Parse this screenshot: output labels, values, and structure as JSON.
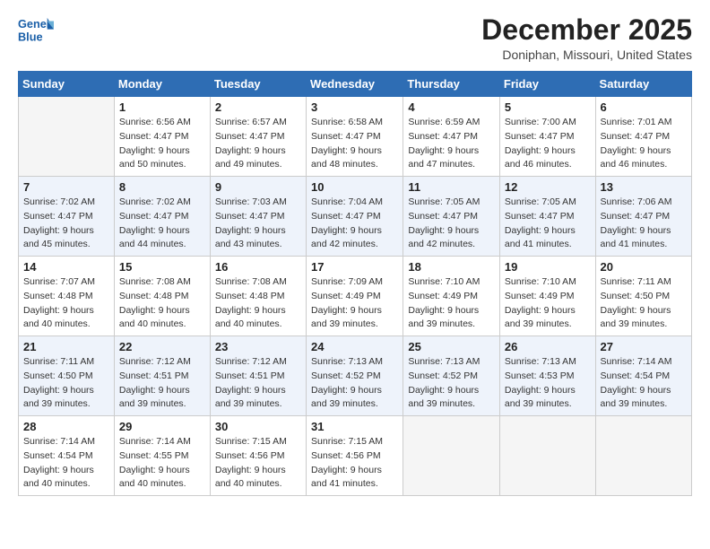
{
  "logo": {
    "general": "General",
    "blue": "Blue"
  },
  "title": "December 2025",
  "location": "Doniphan, Missouri, United States",
  "days_header": [
    "Sunday",
    "Monday",
    "Tuesday",
    "Wednesday",
    "Thursday",
    "Friday",
    "Saturday"
  ],
  "weeks": [
    [
      {
        "num": "",
        "sunrise": "",
        "sunset": "",
        "daylight": ""
      },
      {
        "num": "1",
        "sunrise": "Sunrise: 6:56 AM",
        "sunset": "Sunset: 4:47 PM",
        "daylight": "Daylight: 9 hours and 50 minutes."
      },
      {
        "num": "2",
        "sunrise": "Sunrise: 6:57 AM",
        "sunset": "Sunset: 4:47 PM",
        "daylight": "Daylight: 9 hours and 49 minutes."
      },
      {
        "num": "3",
        "sunrise": "Sunrise: 6:58 AM",
        "sunset": "Sunset: 4:47 PM",
        "daylight": "Daylight: 9 hours and 48 minutes."
      },
      {
        "num": "4",
        "sunrise": "Sunrise: 6:59 AM",
        "sunset": "Sunset: 4:47 PM",
        "daylight": "Daylight: 9 hours and 47 minutes."
      },
      {
        "num": "5",
        "sunrise": "Sunrise: 7:00 AM",
        "sunset": "Sunset: 4:47 PM",
        "daylight": "Daylight: 9 hours and 46 minutes."
      },
      {
        "num": "6",
        "sunrise": "Sunrise: 7:01 AM",
        "sunset": "Sunset: 4:47 PM",
        "daylight": "Daylight: 9 hours and 46 minutes."
      }
    ],
    [
      {
        "num": "7",
        "sunrise": "Sunrise: 7:02 AM",
        "sunset": "Sunset: 4:47 PM",
        "daylight": "Daylight: 9 hours and 45 minutes."
      },
      {
        "num": "8",
        "sunrise": "Sunrise: 7:02 AM",
        "sunset": "Sunset: 4:47 PM",
        "daylight": "Daylight: 9 hours and 44 minutes."
      },
      {
        "num": "9",
        "sunrise": "Sunrise: 7:03 AM",
        "sunset": "Sunset: 4:47 PM",
        "daylight": "Daylight: 9 hours and 43 minutes."
      },
      {
        "num": "10",
        "sunrise": "Sunrise: 7:04 AM",
        "sunset": "Sunset: 4:47 PM",
        "daylight": "Daylight: 9 hours and 42 minutes."
      },
      {
        "num": "11",
        "sunrise": "Sunrise: 7:05 AM",
        "sunset": "Sunset: 4:47 PM",
        "daylight": "Daylight: 9 hours and 42 minutes."
      },
      {
        "num": "12",
        "sunrise": "Sunrise: 7:05 AM",
        "sunset": "Sunset: 4:47 PM",
        "daylight": "Daylight: 9 hours and 41 minutes."
      },
      {
        "num": "13",
        "sunrise": "Sunrise: 7:06 AM",
        "sunset": "Sunset: 4:47 PM",
        "daylight": "Daylight: 9 hours and 41 minutes."
      }
    ],
    [
      {
        "num": "14",
        "sunrise": "Sunrise: 7:07 AM",
        "sunset": "Sunset: 4:48 PM",
        "daylight": "Daylight: 9 hours and 40 minutes."
      },
      {
        "num": "15",
        "sunrise": "Sunrise: 7:08 AM",
        "sunset": "Sunset: 4:48 PM",
        "daylight": "Daylight: 9 hours and 40 minutes."
      },
      {
        "num": "16",
        "sunrise": "Sunrise: 7:08 AM",
        "sunset": "Sunset: 4:48 PM",
        "daylight": "Daylight: 9 hours and 40 minutes."
      },
      {
        "num": "17",
        "sunrise": "Sunrise: 7:09 AM",
        "sunset": "Sunset: 4:49 PM",
        "daylight": "Daylight: 9 hours and 39 minutes."
      },
      {
        "num": "18",
        "sunrise": "Sunrise: 7:10 AM",
        "sunset": "Sunset: 4:49 PM",
        "daylight": "Daylight: 9 hours and 39 minutes."
      },
      {
        "num": "19",
        "sunrise": "Sunrise: 7:10 AM",
        "sunset": "Sunset: 4:49 PM",
        "daylight": "Daylight: 9 hours and 39 minutes."
      },
      {
        "num": "20",
        "sunrise": "Sunrise: 7:11 AM",
        "sunset": "Sunset: 4:50 PM",
        "daylight": "Daylight: 9 hours and 39 minutes."
      }
    ],
    [
      {
        "num": "21",
        "sunrise": "Sunrise: 7:11 AM",
        "sunset": "Sunset: 4:50 PM",
        "daylight": "Daylight: 9 hours and 39 minutes."
      },
      {
        "num": "22",
        "sunrise": "Sunrise: 7:12 AM",
        "sunset": "Sunset: 4:51 PM",
        "daylight": "Daylight: 9 hours and 39 minutes."
      },
      {
        "num": "23",
        "sunrise": "Sunrise: 7:12 AM",
        "sunset": "Sunset: 4:51 PM",
        "daylight": "Daylight: 9 hours and 39 minutes."
      },
      {
        "num": "24",
        "sunrise": "Sunrise: 7:13 AM",
        "sunset": "Sunset: 4:52 PM",
        "daylight": "Daylight: 9 hours and 39 minutes."
      },
      {
        "num": "25",
        "sunrise": "Sunrise: 7:13 AM",
        "sunset": "Sunset: 4:52 PM",
        "daylight": "Daylight: 9 hours and 39 minutes."
      },
      {
        "num": "26",
        "sunrise": "Sunrise: 7:13 AM",
        "sunset": "Sunset: 4:53 PM",
        "daylight": "Daylight: 9 hours and 39 minutes."
      },
      {
        "num": "27",
        "sunrise": "Sunrise: 7:14 AM",
        "sunset": "Sunset: 4:54 PM",
        "daylight": "Daylight: 9 hours and 39 minutes."
      }
    ],
    [
      {
        "num": "28",
        "sunrise": "Sunrise: 7:14 AM",
        "sunset": "Sunset: 4:54 PM",
        "daylight": "Daylight: 9 hours and 40 minutes."
      },
      {
        "num": "29",
        "sunrise": "Sunrise: 7:14 AM",
        "sunset": "Sunset: 4:55 PM",
        "daylight": "Daylight: 9 hours and 40 minutes."
      },
      {
        "num": "30",
        "sunrise": "Sunrise: 7:15 AM",
        "sunset": "Sunset: 4:56 PM",
        "daylight": "Daylight: 9 hours and 40 minutes."
      },
      {
        "num": "31",
        "sunrise": "Sunrise: 7:15 AM",
        "sunset": "Sunset: 4:56 PM",
        "daylight": "Daylight: 9 hours and 41 minutes."
      },
      {
        "num": "",
        "sunrise": "",
        "sunset": "",
        "daylight": ""
      },
      {
        "num": "",
        "sunrise": "",
        "sunset": "",
        "daylight": ""
      },
      {
        "num": "",
        "sunrise": "",
        "sunset": "",
        "daylight": ""
      }
    ]
  ]
}
